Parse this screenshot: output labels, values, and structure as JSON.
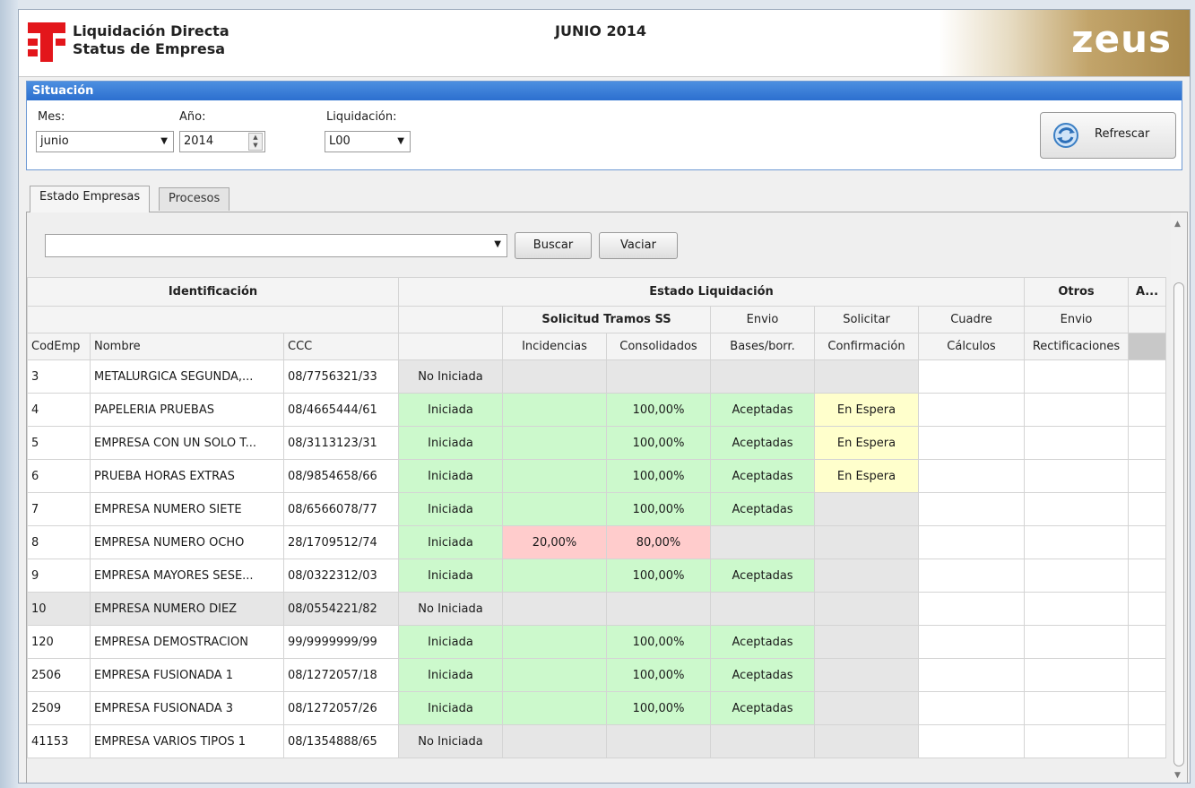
{
  "header": {
    "title": "Liquidación Directa",
    "subtitle": "Status de Empresa",
    "period": "JUNIO 2014",
    "brand": "zeus"
  },
  "situacion": {
    "title": "Situación",
    "mes_label": "Mes:",
    "mes_value": "junio",
    "anio_label": "Año:",
    "anio_value": "2014",
    "liq_label": "Liquidación:",
    "liq_value": "L00",
    "refresh_label": "Refrescar"
  },
  "tabs": [
    {
      "label": "Estado Empresas",
      "active": true
    },
    {
      "label": "Procesos",
      "active": false
    }
  ],
  "search": {
    "value": "",
    "buscar_label": "Buscar",
    "vaciar_label": "Vaciar"
  },
  "table": {
    "group_headers": {
      "identificacion": "Identificación",
      "estado": "Estado Liquidación",
      "otros": "Otros",
      "a": "A..."
    },
    "sub_headers": {
      "solicitud": "Solicitud Tramos SS",
      "envio1": "Envio",
      "solicitar": "Solicitar",
      "cuadre": "Cuadre",
      "envio2": "Envio"
    },
    "columns": [
      "CodEmp",
      "Nombre",
      "CCC",
      "",
      "Incidencias",
      "Consolidados",
      "Bases/borr.",
      "Confirmación",
      "Cálculos",
      "Rectificaciones",
      ""
    ],
    "rows": [
      {
        "cod": "3",
        "nombre": "METALURGICA SEGUNDA,...",
        "ccc": "08/7756321/33",
        "estado": "No Iniciada",
        "inc": "",
        "cons": "",
        "bases": "",
        "conf": ""
      },
      {
        "cod": "4",
        "nombre": "PAPELERIA PRUEBAS",
        "ccc": "08/4665444/61",
        "estado": "Iniciada",
        "inc": "",
        "cons": "100,00%",
        "bases": "Aceptadas",
        "conf": "En Espera"
      },
      {
        "cod": "5",
        "nombre": "EMPRESA CON UN SOLO T...",
        "ccc": "08/3113123/31",
        "estado": "Iniciada",
        "inc": "",
        "cons": "100,00%",
        "bases": "Aceptadas",
        "conf": "En Espera"
      },
      {
        "cod": "6",
        "nombre": "PRUEBA HORAS EXTRAS",
        "ccc": "08/9854658/66",
        "estado": "Iniciada",
        "inc": "",
        "cons": "100,00%",
        "bases": "Aceptadas",
        "conf": "En Espera"
      },
      {
        "cod": "7",
        "nombre": "EMPRESA NUMERO SIETE",
        "ccc": "08/6566078/77",
        "estado": "Iniciada",
        "inc": "",
        "cons": "100,00%",
        "bases": "Aceptadas",
        "conf": ""
      },
      {
        "cod": "8",
        "nombre": "EMPRESA NUMERO OCHO",
        "ccc": "28/1709512/74",
        "estado": "Iniciada",
        "inc": "20,00%",
        "cons": "80,00%",
        "bases": "",
        "conf": ""
      },
      {
        "cod": "9",
        "nombre": "EMPRESA MAYORES SESE...",
        "ccc": "08/0322312/03",
        "estado": "Iniciada",
        "inc": "",
        "cons": "100,00%",
        "bases": "Aceptadas",
        "conf": ""
      },
      {
        "cod": "10",
        "nombre": "EMPRESA NUMERO DIEZ",
        "ccc": "08/0554221/82",
        "estado": "No Iniciada",
        "inc": "",
        "cons": "",
        "bases": "",
        "conf": ""
      },
      {
        "cod": "120",
        "nombre": "EMPRESA  DEMOSTRACION",
        "ccc": "99/9999999/99",
        "estado": "Iniciada",
        "inc": "",
        "cons": "100,00%",
        "bases": "Aceptadas",
        "conf": ""
      },
      {
        "cod": "2506",
        "nombre": "EMPRESA FUSIONADA 1",
        "ccc": "08/1272057/18",
        "estado": "Iniciada",
        "inc": "",
        "cons": "100,00%",
        "bases": "Aceptadas",
        "conf": ""
      },
      {
        "cod": "2509",
        "nombre": "EMPRESA FUSIONADA 3",
        "ccc": "08/1272057/26",
        "estado": "Iniciada",
        "inc": "",
        "cons": "100,00%",
        "bases": "Aceptadas",
        "conf": ""
      },
      {
        "cod": "41153",
        "nombre": "EMPRESA VARIOS TIPOS 1",
        "ccc": "08/1354888/65",
        "estado": "No Iniciada",
        "inc": "",
        "cons": "",
        "bases": "",
        "conf": ""
      }
    ]
  },
  "colors": {
    "green": "#ccf9cc",
    "yellow": "#ffffcc",
    "red": "#ffcccc",
    "gray": "#e6e6e6",
    "accent": "#2c6fcf",
    "logo_red": "#e3161b"
  }
}
